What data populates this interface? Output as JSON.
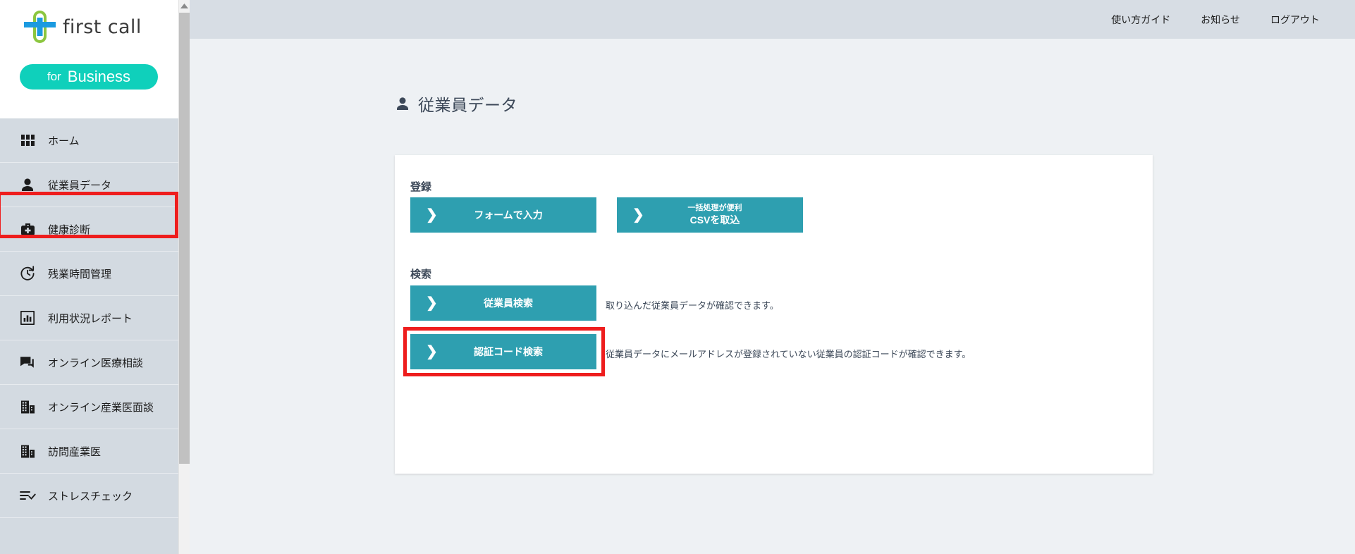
{
  "sidebar": {
    "logo": {
      "mark_icon": "first-call-cross-logo-icon",
      "wordmark": "first call",
      "pill_prefix": "for",
      "pill_name": "Business",
      "pill_color": "#0fd0bb"
    },
    "items": [
      {
        "label": "ホーム",
        "icon": "grid-icon"
      },
      {
        "label": "従業員データ",
        "icon": "person-icon"
      },
      {
        "label": "健康診断",
        "icon": "medical-bag-icon"
      },
      {
        "label": "残業時間管理",
        "icon": "clock-refresh-icon"
      },
      {
        "label": "利用状況レポート",
        "icon": "bar-chart-icon"
      },
      {
        "label": "オンライン医療相談",
        "icon": "chat-bubble-icon"
      },
      {
        "label": "オンライン産業医面談",
        "icon": "building-icon"
      },
      {
        "label": "訪問産業医",
        "icon": "building-icon"
      },
      {
        "label": "ストレスチェック",
        "icon": "list-check-icon"
      }
    ],
    "scrollbar": {
      "up_arrow_icon": "scroll-up-arrow-icon"
    }
  },
  "header": {
    "links": [
      {
        "label": "使い方ガイド"
      },
      {
        "label": "お知らせ"
      },
      {
        "label": "ログアウト"
      }
    ]
  },
  "main": {
    "page_title": "従業員データ",
    "page_title_icon": "person-icon",
    "sections": [
      {
        "heading": "登録",
        "buttons": [
          {
            "label": "フォームで入力",
            "sub": "",
            "chevron": "chevron-right-icon"
          },
          {
            "label": "CSVを取込",
            "sub": "一括処理が便利",
            "chevron": "chevron-right-icon"
          }
        ]
      },
      {
        "heading": "検索",
        "rows": [
          {
            "label": "従業員検索",
            "chevron": "chevron-right-icon",
            "description": "取り込んだ従業員データが確認できます。",
            "highlighted": false
          },
          {
            "label": "認証コード検索",
            "chevron": "chevron-right-icon",
            "description": "従業員データにメールアドレスが登録されていない従業員の認証コードが確認できます。",
            "highlighted": true
          }
        ]
      }
    ]
  },
  "colors": {
    "button_teal": "#2e9fb0",
    "sidebar_bg": "#d3dae1",
    "header_bg": "#d7dde4",
    "page_bg": "#eef1f4",
    "annotation_red": "#ee1d1d",
    "card_bg": "#ffffff",
    "title_text": "#3c4858"
  },
  "annotations": [
    {
      "target": "sidebar-item-employee-data",
      "color": "#ee1d1d"
    },
    {
      "target": "auth-code-search-button",
      "color": "#ee1d1d"
    }
  ],
  "glyphs": {
    "chevron_right": "❯"
  }
}
